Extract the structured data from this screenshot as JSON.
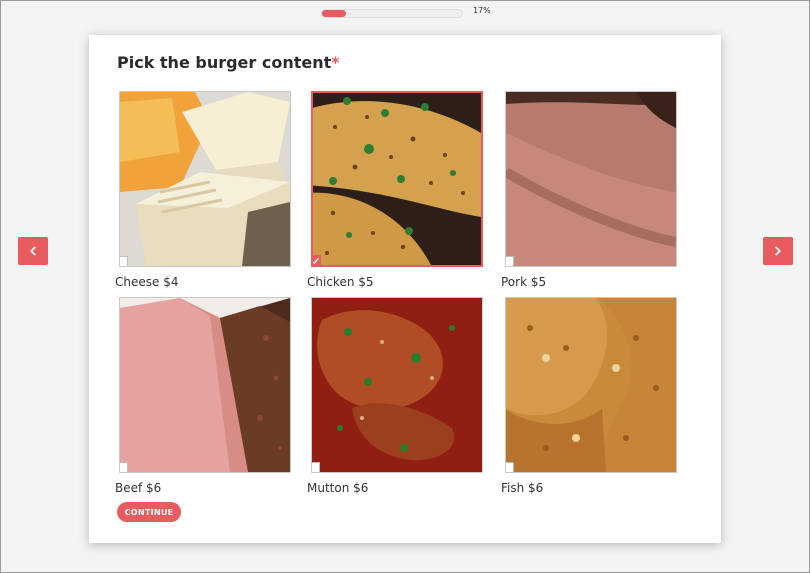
{
  "progress": {
    "percent": 17,
    "label": "17%"
  },
  "question": {
    "title": "Pick the burger content",
    "required_mark": "*"
  },
  "options": [
    {
      "label": "Cheese $4",
      "selected": false,
      "icon": "cheese-image"
    },
    {
      "label": "Chicken $5",
      "selected": true,
      "icon": "chicken-image"
    },
    {
      "label": "Pork $5",
      "selected": false,
      "icon": "pork-image"
    },
    {
      "label": "Beef $6",
      "selected": false,
      "icon": "beef-image"
    },
    {
      "label": "Mutton $6",
      "selected": false,
      "icon": "mutton-image"
    },
    {
      "label": "Fish $6",
      "selected": false,
      "icon": "fish-image"
    }
  ],
  "buttons": {
    "continue": "CONTINUE"
  },
  "colors": {
    "accent": "#e85b5f"
  }
}
